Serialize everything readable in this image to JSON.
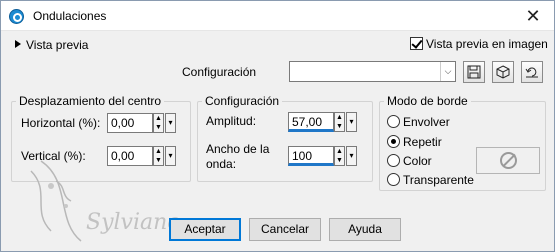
{
  "window": {
    "title": "Ondulaciones",
    "close_glyph": "✕"
  },
  "preview": {
    "toggle_label": "Vista previa",
    "image_checkbox_label": "Vista previa en imagen",
    "image_checked": true
  },
  "config": {
    "label": "Configuración",
    "value": "",
    "toolbar_icons": [
      "save-icon",
      "random-dice-icon",
      "reset-icon"
    ]
  },
  "displacement": {
    "legend": "Desplazamiento del centro",
    "horizontal_label": "Horizontal (%):",
    "horizontal_value": "0,00",
    "vertical_label": "Vertical (%):",
    "vertical_value": "0,00"
  },
  "settings": {
    "legend": "Configuración",
    "amplitude_label": "Amplitud:",
    "amplitude_value": "57,00",
    "width_label_1": "Ancho de la",
    "width_label_2": "onda:",
    "width_value": "100"
  },
  "edge_mode": {
    "legend": "Modo de borde",
    "options": [
      {
        "label": "Envolver",
        "selected": false
      },
      {
        "label": "Repetir",
        "selected": true
      },
      {
        "label": "Color",
        "selected": false
      },
      {
        "label": "Transparente",
        "selected": false
      }
    ]
  },
  "buttons": {
    "ok": "Aceptar",
    "cancel": "Cancelar",
    "help": "Ayuda"
  },
  "watermark_text": "Sylviane",
  "colors": {
    "accent": "#0078d7",
    "slider_blue": "#1f77c8"
  }
}
